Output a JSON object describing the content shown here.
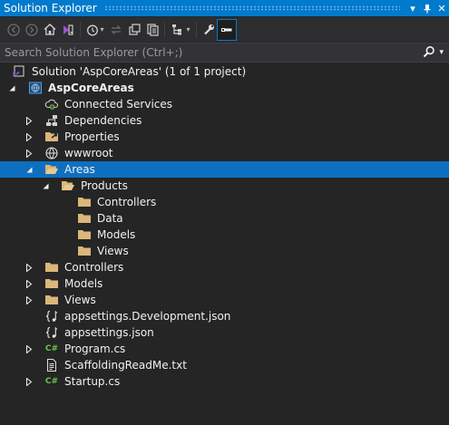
{
  "window": {
    "title": "Solution Explorer"
  },
  "search": {
    "placeholder": "Search Solution Explorer (Ctrl+;)"
  },
  "colors": {
    "accent": "#007acc",
    "selection": "#0e6fc1",
    "folder": "#dcb67a",
    "background": "#252526"
  },
  "tree": {
    "solution": "Solution 'AspCoreAreas' (1 of 1 project)",
    "project": "AspCoreAreas",
    "connected_services": "Connected Services",
    "dependencies": "Dependencies",
    "properties": "Properties",
    "wwwroot": "wwwroot",
    "areas": "Areas",
    "products": "Products",
    "area_controllers": "Controllers",
    "area_data": "Data",
    "area_models": "Models",
    "area_views": "Views",
    "controllers": "Controllers",
    "models": "Models",
    "views": "Views",
    "appsettings_dev": "appsettings.Development.json",
    "appsettings": "appsettings.json",
    "program": "Program.cs",
    "readme": "ScaffoldingReadMe.txt",
    "startup": "Startup.cs"
  },
  "icons": {
    "csharp_badge": "C#"
  }
}
